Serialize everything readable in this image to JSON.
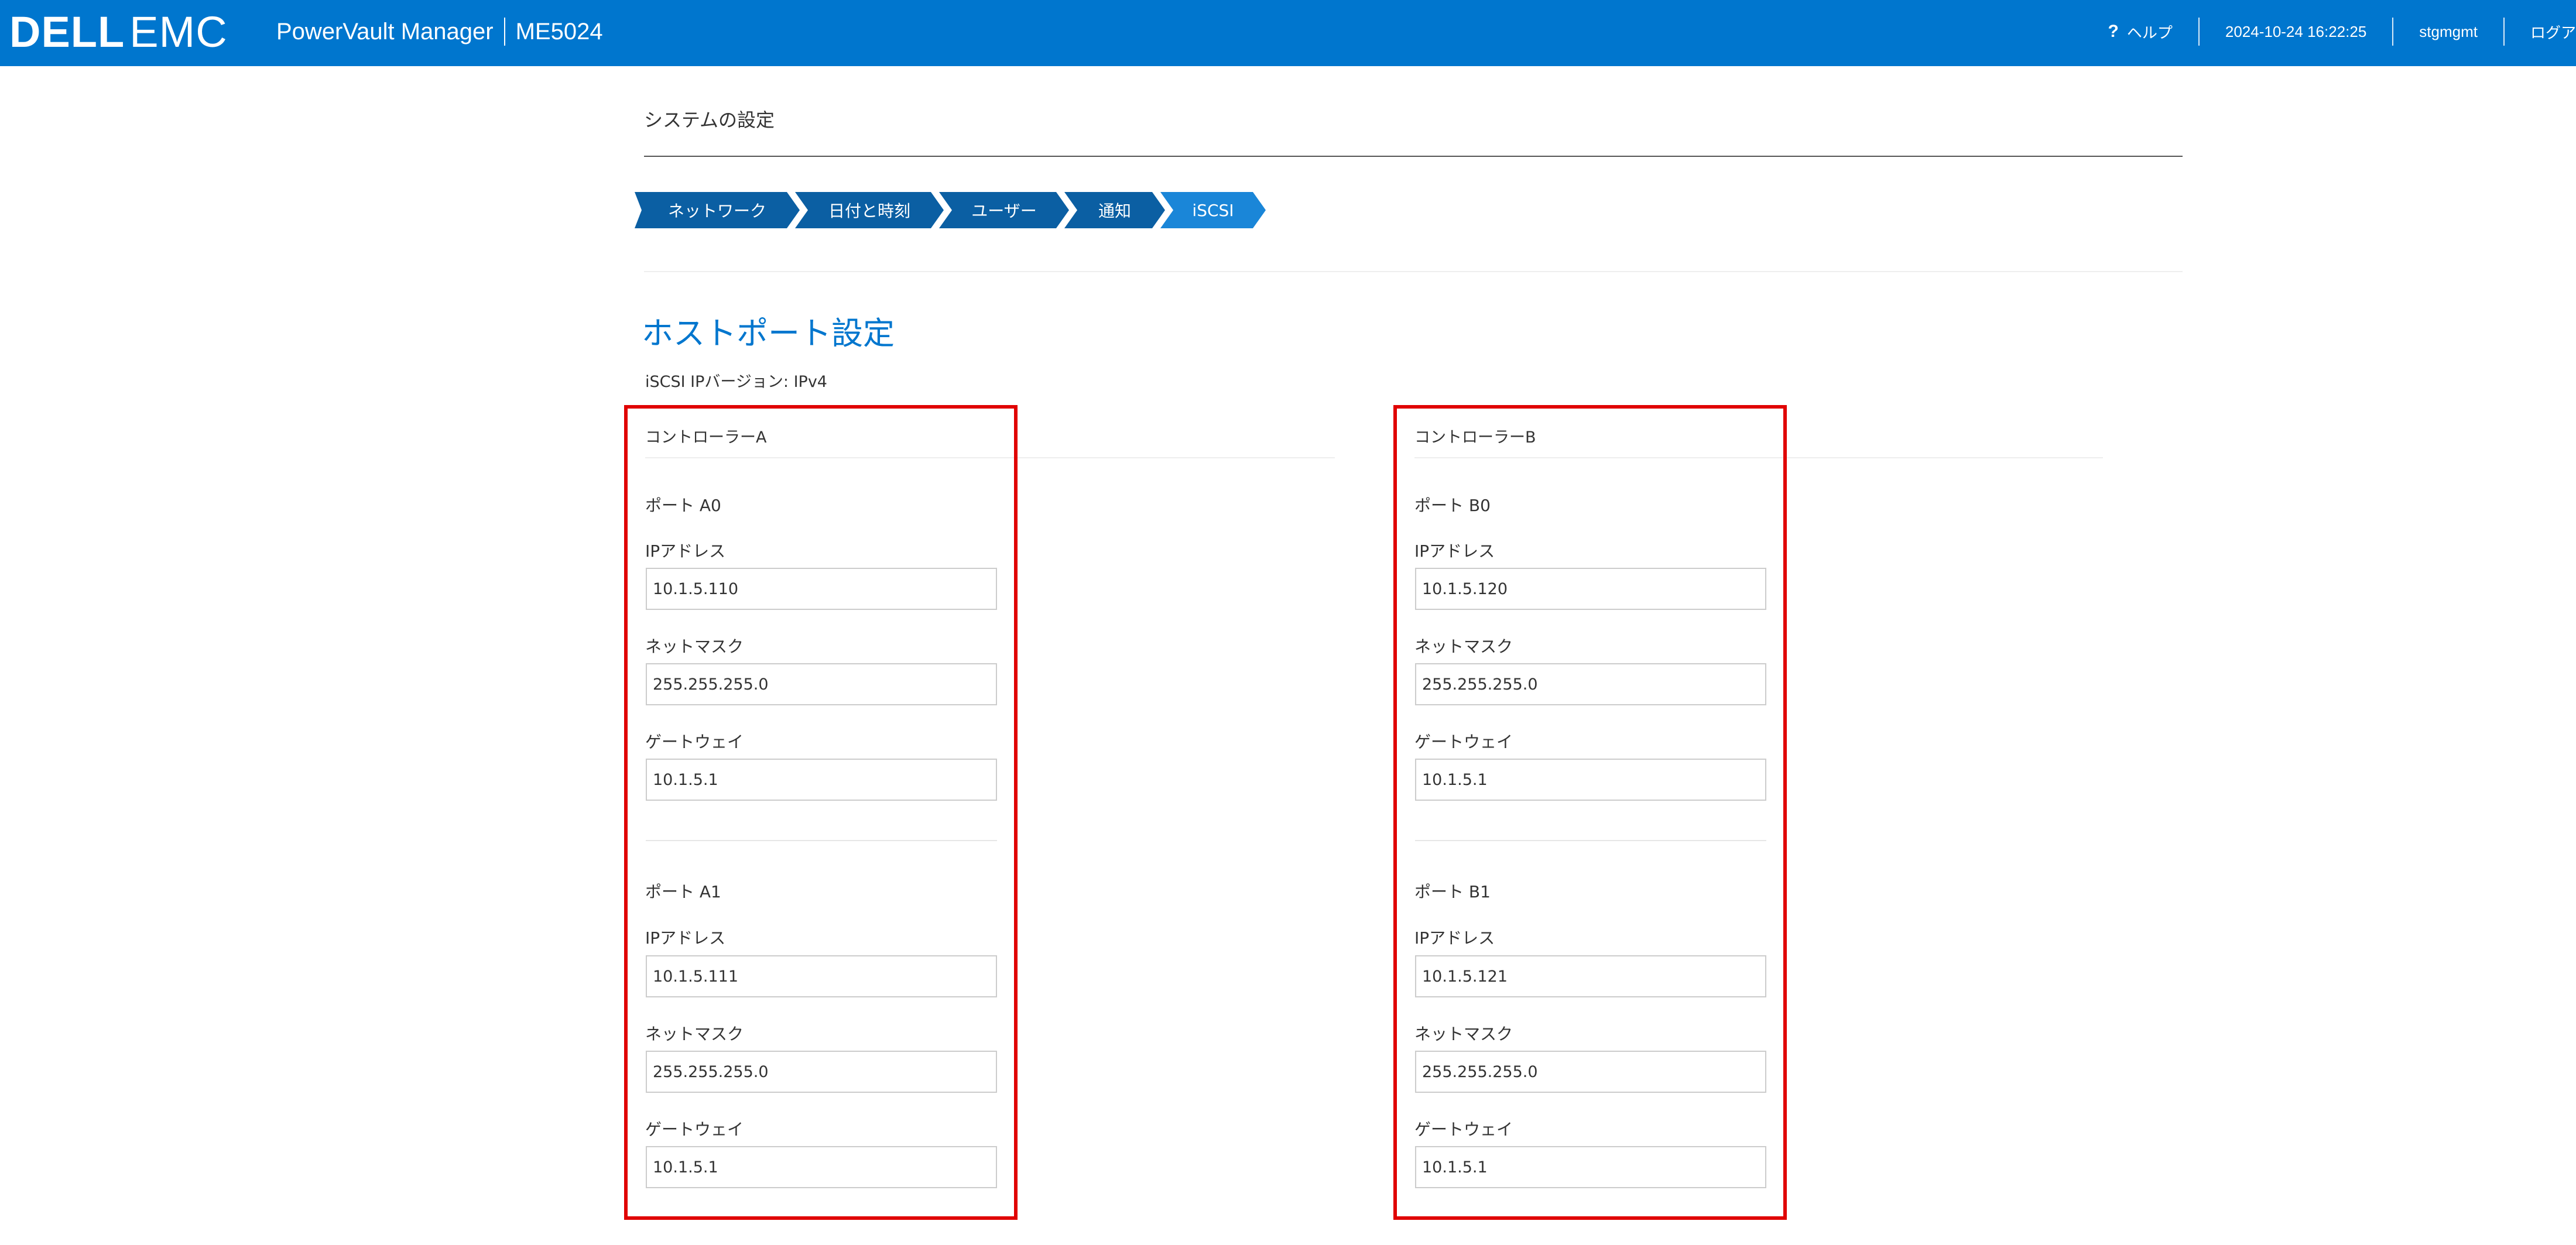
{
  "header": {
    "logo_dell": "DELL",
    "logo_emc": "EMC",
    "app_name": "PowerVault Manager",
    "model": "ME5024",
    "help_label": "ヘルプ",
    "datetime": "2024-10-24 16:22:25",
    "user": "stgmgmt",
    "logout_label": "ログア"
  },
  "page": {
    "title": "システムの設定"
  },
  "wizard": {
    "steps": [
      "ネットワーク",
      "日付と時刻",
      "ユーザー",
      "通知",
      "iSCSI"
    ],
    "active_index": 4
  },
  "section": {
    "title": "ホストポート設定",
    "ip_version_label": "iSCSI IPバージョン:",
    "ip_version_value": "IPv4"
  },
  "labels": {
    "ip_address": "IPアドレス",
    "netmask": "ネットマスク",
    "gateway": "ゲートウェイ"
  },
  "controllers": [
    {
      "name": "コントローラーA",
      "ports": [
        {
          "name": "ポート A0",
          "ip": "10.1.5.110",
          "netmask": "255.255.255.0",
          "gateway": "10.1.5.1"
        },
        {
          "name": "ポート A1",
          "ip": "10.1.5.111",
          "netmask": "255.255.255.0",
          "gateway": "10.1.5.1"
        }
      ]
    },
    {
      "name": "コントローラーB",
      "ports": [
        {
          "name": "ポート B0",
          "ip": "10.1.5.120",
          "netmask": "255.255.255.0",
          "gateway": "10.1.5.1"
        },
        {
          "name": "ポート B1",
          "ip": "10.1.5.121",
          "netmask": "255.255.255.0",
          "gateway": "10.1.5.1"
        }
      ]
    }
  ],
  "colors": {
    "header_bg": "#0076ce",
    "step_bg": "#0b5fa3",
    "step_active_bg": "#1a86d8",
    "highlight": "#e00000",
    "section_title": "#0076ce"
  }
}
